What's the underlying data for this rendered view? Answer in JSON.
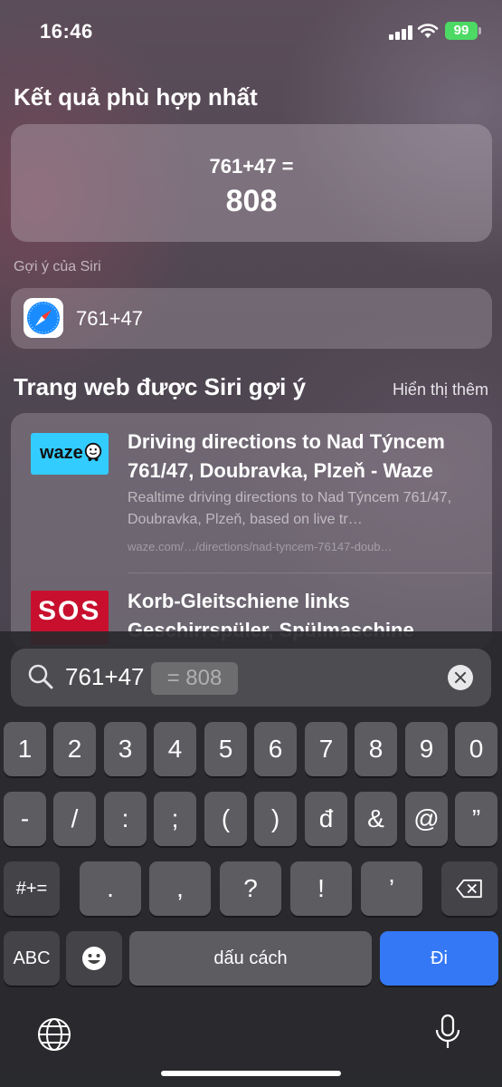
{
  "status": {
    "time": "16:46",
    "battery": "99"
  },
  "best_match": {
    "title": "Kết quả phù hợp nhất",
    "expression": "761+47 =",
    "result": "808"
  },
  "siri_suggestions": {
    "label": "Gợi ý của Siri",
    "item": "761+47"
  },
  "web": {
    "title": "Trang web được Siri gợi ý",
    "show_more": "Hiển thị thêm",
    "results": [
      {
        "logo": "waze",
        "title": "Driving directions to Nad Týncem 761/47, Doubravka, Plzeň - Waze",
        "description": "Realtime driving directions to Nad Týncem 761/47, Doubravka, Plzeň, based on live tr…",
        "url": "waze.com/…/directions/nad-tyncem-76147-doub…"
      },
      {
        "logo": "SOS",
        "title": "Korb-Gleitschiene links Geschirrspüler, Spülmaschine"
      }
    ]
  },
  "search": {
    "query": "761+47",
    "inline_result": "= 808"
  },
  "keyboard": {
    "row1": [
      "1",
      "2",
      "3",
      "4",
      "5",
      "6",
      "7",
      "8",
      "9",
      "0"
    ],
    "row2": [
      "-",
      "/",
      ":",
      ";",
      "(",
      ")",
      "đ",
      "&",
      "@",
      "”"
    ],
    "row3": [
      "#+=",
      ".",
      ",",
      "?",
      "!",
      "’"
    ],
    "abc": "ABC",
    "space": "dấu cách",
    "go": "Đi"
  },
  "icons": [
    "safari-icon",
    "search-icon",
    "clear-icon",
    "backspace-icon",
    "emoji-icon",
    "globe-icon",
    "microphone-icon",
    "wifi-icon",
    "signal-icon"
  ]
}
